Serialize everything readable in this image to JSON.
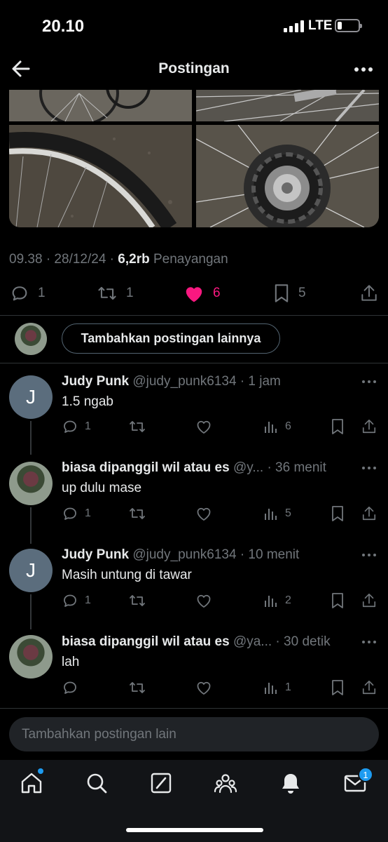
{
  "status_bar": {
    "time": "20.10",
    "network": "LTE"
  },
  "header": {
    "title": "Postingan"
  },
  "post": {
    "meta_time": "09.38 · 28/12/24 · ",
    "views_count": "6,2rb",
    "views_label": " Penayangan",
    "actions": {
      "replies": "1",
      "reposts": "1",
      "likes": "6",
      "bookmarks": "5"
    }
  },
  "add_post": {
    "label": "Tambahkan postingan lainnya"
  },
  "replies": [
    {
      "avatar_letter": "J",
      "name": "Judy Punk",
      "handle": "@judy_punk6134 · 1 jam",
      "text": "1.5 ngab",
      "replies": "1",
      "reposts": "",
      "likes": "",
      "views": "6"
    },
    {
      "avatar_letter": "",
      "name": "biasa dipanggil wil atau es",
      "handle": "@y... · 36 menit",
      "text": "up dulu mase",
      "replies": "1",
      "reposts": "",
      "likes": "",
      "views": "5"
    },
    {
      "avatar_letter": "J",
      "name": "Judy Punk",
      "handle": "@judy_punk6134 · 10 menit",
      "text": "Masih untung di tawar",
      "replies": "1",
      "reposts": "",
      "likes": "",
      "views": "2"
    },
    {
      "avatar_letter": "",
      "name": "biasa dipanggil wil atau es",
      "handle": "@ya... · 30 detik",
      "text": "lah",
      "replies": "",
      "reposts": "",
      "likes": "",
      "views": "1"
    }
  ],
  "compose": {
    "placeholder": "Tambahkan postingan lain"
  },
  "bottom_nav": {
    "items": [
      "home-icon",
      "search-icon",
      "grok-icon",
      "communities-icon",
      "notifications-icon",
      "messages-icon"
    ],
    "messages_badge": "1"
  },
  "colors": {
    "accent": "#1d9bf0",
    "like": "#f91880",
    "muted": "#71767b",
    "background": "#000000"
  }
}
